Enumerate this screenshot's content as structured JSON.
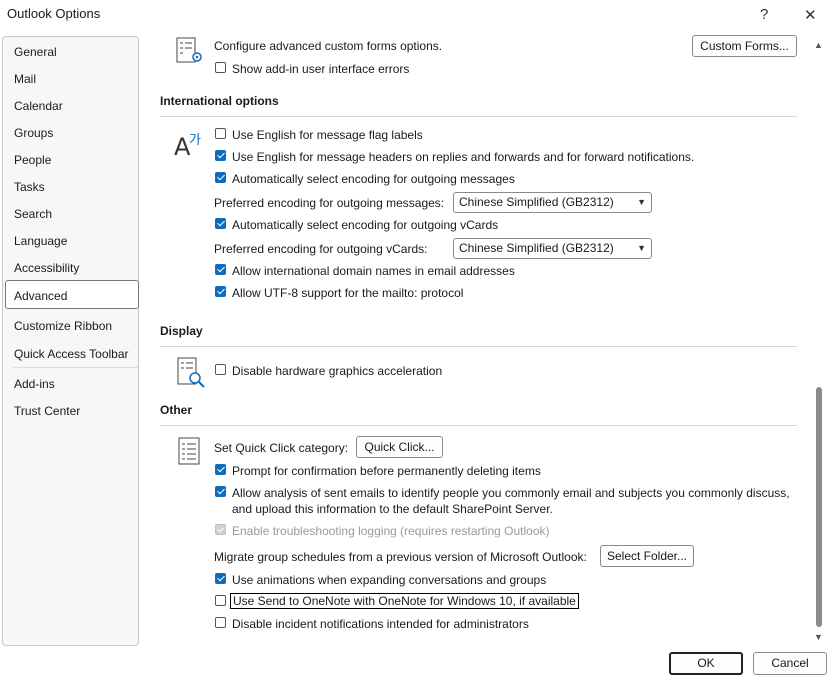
{
  "window": {
    "title": "Outlook Options",
    "help_icon": "?",
    "close_icon": "✕"
  },
  "sidebar": {
    "items": [
      {
        "label": "General"
      },
      {
        "label": "Mail"
      },
      {
        "label": "Calendar"
      },
      {
        "label": "Groups"
      },
      {
        "label": "People"
      },
      {
        "label": "Tasks"
      },
      {
        "label": "Search"
      },
      {
        "label": "Language"
      },
      {
        "label": "Accessibility"
      },
      {
        "label": "Advanced",
        "selected": true
      },
      {
        "label": "Customize Ribbon"
      },
      {
        "label": "Quick Access Toolbar"
      },
      {
        "label": "Add-ins"
      },
      {
        "label": "Trust Center"
      }
    ]
  },
  "forms": {
    "label": "Configure advanced custom forms options.",
    "button": "Custom Forms...",
    "addin_errors": {
      "label": "Show add-in user interface errors",
      "checked": false
    }
  },
  "international": {
    "heading": "International options",
    "flag_labels": {
      "label": "Use English for message flag labels",
      "checked": false
    },
    "headers_english": {
      "label": "Use English for message headers on replies and forwards and for forward notifications.",
      "checked": true
    },
    "auto_encoding": {
      "label": "Automatically select encoding for outgoing messages",
      "checked": true
    },
    "pref_encoding_messages": {
      "label": "Preferred encoding for outgoing messages:",
      "value": "Chinese Simplified (GB2312)"
    },
    "auto_vcards": {
      "label": "Automatically select encoding for outgoing vCards",
      "checked": true
    },
    "pref_encoding_vcards": {
      "label": "Preferred encoding for outgoing vCards:",
      "value": "Chinese Simplified (GB2312)"
    },
    "intl_domains": {
      "label": "Allow international domain names in email addresses",
      "checked": true
    },
    "utf8_mailto": {
      "label": "Allow UTF-8 support for the mailto: protocol",
      "checked": true
    }
  },
  "display": {
    "heading": "Display",
    "hw_accel": {
      "label": "Disable hardware graphics acceleration",
      "checked": false
    }
  },
  "other": {
    "heading": "Other",
    "quick_click": {
      "label": "Set Quick Click category:",
      "button": "Quick Click..."
    },
    "confirm_delete": {
      "label": "Prompt for confirmation before permanently deleting items",
      "checked": true
    },
    "analysis": {
      "line1": "Allow analysis of sent emails to identify people you commonly email and subjects you commonly discuss,",
      "line2": "and upload this information to the default SharePoint Server.",
      "checked": true
    },
    "troubleshooting": {
      "label": "Enable troubleshooting logging (requires restarting Outlook)",
      "checked": true,
      "disabled": true
    },
    "migrate": {
      "label": "Migrate group schedules from a previous version of Microsoft Outlook:",
      "button": "Select Folder..."
    },
    "animations": {
      "label": "Use animations when expanding conversations and groups",
      "checked": true
    },
    "onenote": {
      "label": "Use Send to OneNote with OneNote for Windows 10, if available",
      "checked": false
    },
    "incident": {
      "label": "Disable incident notifications intended for administrators",
      "checked": false
    }
  },
  "footer": {
    "ok": "OK",
    "cancel": "Cancel"
  },
  "colors": {
    "accent": "#0f6cbd"
  },
  "icons": [
    "forms-icon",
    "language-icon",
    "display-icon",
    "list-icon",
    "help-icon",
    "close-icon",
    "chevron-down-icon",
    "scroll-up-icon",
    "scroll-down-icon"
  ]
}
